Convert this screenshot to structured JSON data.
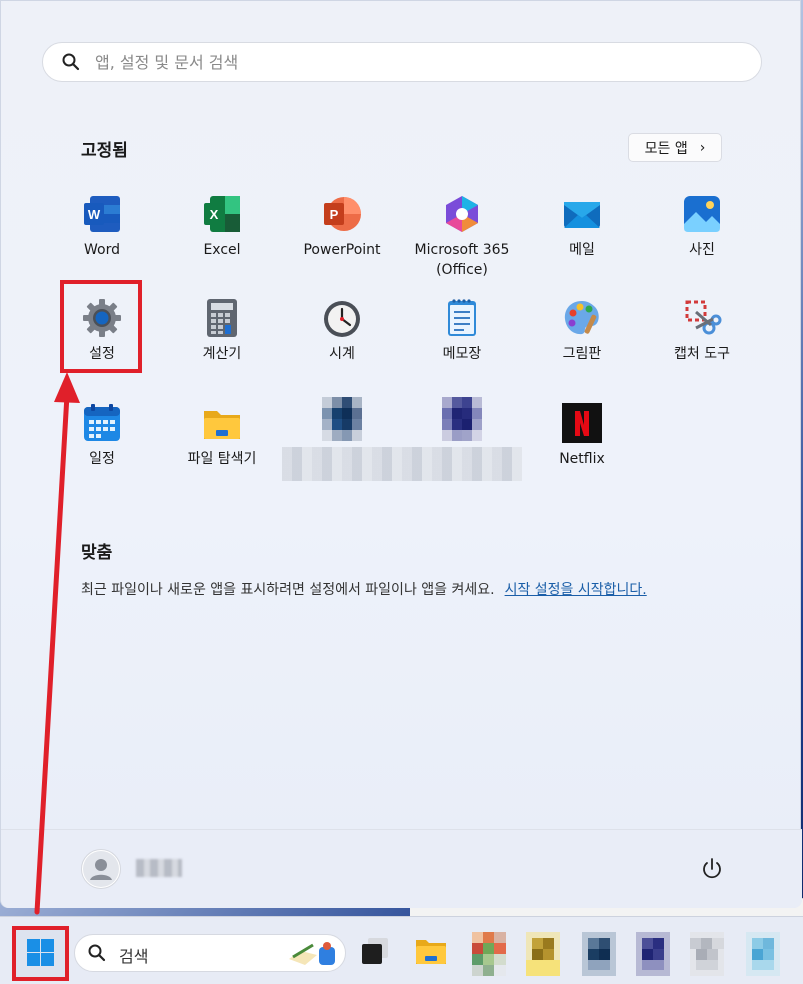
{
  "search": {
    "placeholder": "앱, 설정 및 문서 검색"
  },
  "pinned": {
    "title": "고정됨",
    "all_apps_label": "모든 앱",
    "apps": [
      {
        "label": "Word"
      },
      {
        "label": "Excel"
      },
      {
        "label": "PowerPoint"
      },
      {
        "label": "Microsoft 365\n(Office)"
      },
      {
        "label": "메일"
      },
      {
        "label": "사진"
      },
      {
        "label": "설정"
      },
      {
        "label": "계산기"
      },
      {
        "label": "시계"
      },
      {
        "label": "메모장"
      },
      {
        "label": "그림판"
      },
      {
        "label": "캡처 도구"
      },
      {
        "label": "일정"
      },
      {
        "label": "파일 탐색기"
      },
      {
        "label": "Netflix"
      }
    ]
  },
  "recommended": {
    "title": "맞춤",
    "text": "최근 파일이나 새로운 앱을 표시하려면 설정에서 파일이나 앱을 켜세요.",
    "link": "시작 설정을 시작합니다."
  },
  "taskbar": {
    "search_label": "검색"
  },
  "colors": {
    "highlight": "#e0202a",
    "link": "#1a5ea8"
  }
}
